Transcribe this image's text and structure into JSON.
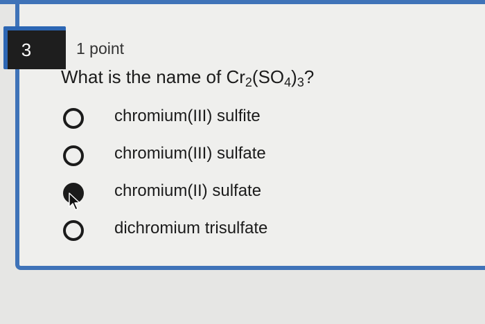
{
  "question": {
    "number": "3",
    "points": "1 point",
    "prompt_prefix": "What is the name of Cr",
    "formula_sub_1": "2",
    "formula_mid": "(SO",
    "formula_sub_2": "4",
    "formula_close": ")",
    "formula_sub_3": "3",
    "prompt_suffix": "?"
  },
  "options": [
    {
      "label": "chromium(III) sulfite",
      "selected": false
    },
    {
      "label": "chromium(III) sulfate",
      "selected": false
    },
    {
      "label": "chromium(II) sulfate",
      "selected": true
    },
    {
      "label": "dichromium trisulfate",
      "selected": false
    }
  ],
  "colors": {
    "accent": "#3f73b8",
    "badge": "#1e1e1e",
    "background": "#e6e6e4"
  },
  "icons": {
    "cursor": "mouse-pointer-icon"
  }
}
